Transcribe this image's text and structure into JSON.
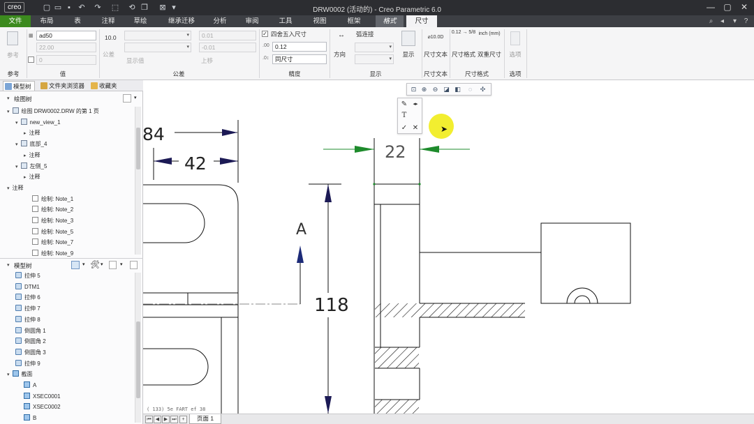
{
  "app": {
    "logo": "creo",
    "title": "DRW0002 (活动的) - Creo Parametric 6.0"
  },
  "quick_access": [
    "new-icon",
    "open-icon",
    "save-icon",
    "undo-icon",
    "redo-icon",
    "select-box-icon",
    "regenerate-icon",
    "windows-icon",
    "close-window-icon",
    "customize-icon"
  ],
  "window_controls": [
    "minimize",
    "maximize",
    "close"
  ],
  "tabs": {
    "file": "文件",
    "items": [
      "布局",
      "表",
      "注释",
      "草绘",
      "继承迁移",
      "分析",
      "审阅",
      "工具",
      "视图",
      "框架"
    ],
    "context": "格式",
    "active": "尺寸"
  },
  "ribbon": {
    "groups": {
      "reference": "参考",
      "value": "值",
      "tolerance": "公差",
      "precision": "精度",
      "display": "显示",
      "dim_text": "尺寸文本",
      "dim_format": "尺寸格式",
      "options": "选项"
    },
    "value_name": "ad50",
    "value_nominal": "22.00",
    "value_override": "0",
    "tolerance_value": "10.0",
    "tolerance_label": "公差",
    "upper_tol": "0.01",
    "lower_tol": "-0.01",
    "show_value": "显示值",
    "upper_label": "上移",
    "round_label": "四舍五入尺寸",
    "round_checked": true,
    "decimal_value": "0.12",
    "decimal_same": "同尺寸",
    "direction_label": "方向",
    "arc_label": "弧连接",
    "display_btn": "显示",
    "dim_text_btn": "尺寸文本",
    "dim_text_glyph": "⌀10.0D",
    "dim_format_btn": "尺寸格式",
    "dual_dim_btn": "双重尺寸",
    "fraction_glyph": "0.12 → 5/8",
    "dual_glyph": "inch (mm)",
    "options_btn": "选项"
  },
  "left_panel": {
    "tabs": [
      "模型树",
      "文件夹浏览器",
      "收藏夹"
    ],
    "drawing_tree_label": "绘图树",
    "drawing_tree": [
      {
        "label": "绘图 DRW0002.DRW 的第 1 页",
        "indent": 0,
        "expand": "▾",
        "icon": "drawing"
      },
      {
        "label": "new_view_1",
        "indent": 1,
        "expand": "▾",
        "icon": "view"
      },
      {
        "label": "注释",
        "indent": 2,
        "expand": "▸",
        "icon": ""
      },
      {
        "label": "底部_4",
        "indent": 1,
        "expand": "▾",
        "icon": "view"
      },
      {
        "label": "注释",
        "indent": 2,
        "expand": "▸",
        "icon": ""
      },
      {
        "label": "左侧_5",
        "indent": 1,
        "expand": "▾",
        "icon": "view"
      },
      {
        "label": "注释",
        "indent": 2,
        "expand": "▸",
        "icon": ""
      },
      {
        "label": "注释",
        "indent": 0,
        "expand": "▾",
        "icon": ""
      },
      {
        "label": "绘制: Note_1",
        "indent": 3,
        "expand": "",
        "icon": "note"
      },
      {
        "label": "绘制: Note_2",
        "indent": 3,
        "expand": "",
        "icon": "note"
      },
      {
        "label": "绘制: Note_3",
        "indent": 3,
        "expand": "",
        "icon": "note"
      },
      {
        "label": "绘制: Note_5",
        "indent": 3,
        "expand": "",
        "icon": "note"
      },
      {
        "label": "绘制: Note_7",
        "indent": 3,
        "expand": "",
        "icon": "note"
      },
      {
        "label": "绘制: Note_9",
        "indent": 3,
        "expand": "",
        "icon": "note"
      }
    ],
    "model_tree_label": "模型树",
    "model_tree": [
      {
        "label": "拉伸 5",
        "indent": 1,
        "expand": "",
        "icon": "feat"
      },
      {
        "label": "DTM1",
        "indent": 1,
        "expand": "",
        "icon": "feat"
      },
      {
        "label": "拉伸 6",
        "indent": 1,
        "expand": "",
        "icon": "feat"
      },
      {
        "label": "拉伸 7",
        "indent": 1,
        "expand": "",
        "icon": "feat"
      },
      {
        "label": "拉伸 8",
        "indent": 1,
        "expand": "",
        "icon": "feat"
      },
      {
        "label": "倒圆角 1",
        "indent": 1,
        "expand": "",
        "icon": "feat"
      },
      {
        "label": "倒圆角 2",
        "indent": 1,
        "expand": "",
        "icon": "feat"
      },
      {
        "label": "倒圆角 3",
        "indent": 1,
        "expand": "",
        "icon": "feat"
      },
      {
        "label": "拉伸 9",
        "indent": 1,
        "expand": "",
        "icon": "feat"
      },
      {
        "label": "截面",
        "indent": 0,
        "expand": "▾",
        "icon": "xsec"
      },
      {
        "label": "A",
        "indent": 2,
        "expand": "",
        "icon": "xsec"
      },
      {
        "label": "XSEC0001",
        "indent": 2,
        "expand": "",
        "icon": "xsec"
      },
      {
        "label": "XSEC0002",
        "indent": 2,
        "expand": "",
        "icon": "xsec"
      },
      {
        "label": "B",
        "indent": 2,
        "expand": "",
        "icon": "xsec"
      }
    ]
  },
  "drawing": {
    "dim_84": "84",
    "dim_42": "42",
    "dim_22": "22",
    "dim_118": "118",
    "section_label": "A",
    "footer_note": "( 133)  5e  FART  ef  38",
    "arrow_colors": {
      "dark": "#1c1a55",
      "selected": "#1e8b2c",
      "section": "#1c2a78"
    }
  },
  "sheet": {
    "nav": [
      "⏮",
      "◀",
      "▶",
      "⏭",
      "+"
    ],
    "tab": "页面 1"
  }
}
